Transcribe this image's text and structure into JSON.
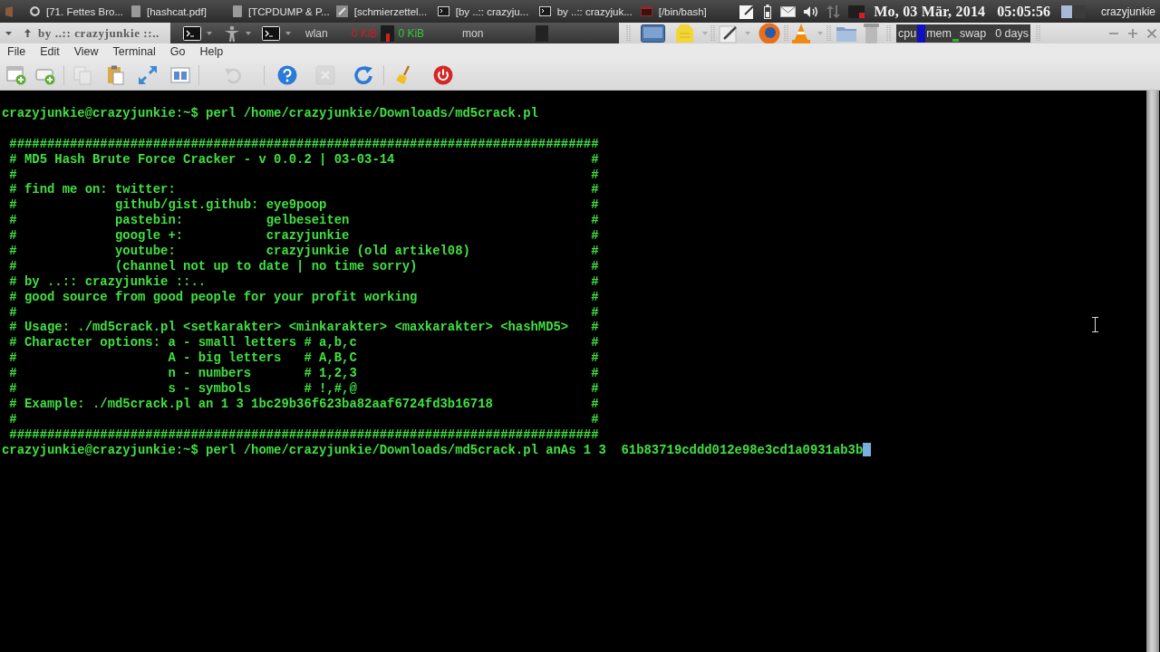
{
  "taskbar": {
    "tasks": [
      {
        "label": "[71. Fettes Bro..."
      },
      {
        "label": "[hashcat.pdf]"
      },
      {
        "label": "[TCPDUMP & P..."
      },
      {
        "label": "[schmierzettel..."
      },
      {
        "label": "[by ..:: crazyju..."
      },
      {
        "label": "by ..:: crazyjuk..."
      },
      {
        "label": "[/bin/bash]"
      }
    ],
    "date": "Mo, 03 Mär, 2014",
    "time": "05:05:56",
    "user": "crazyjunkie"
  },
  "window": {
    "title": "by ..:: crazyjunkie ::.."
  },
  "panel": {
    "network_label": "wlan",
    "upload": "0 KiB",
    "download": "0 KiB",
    "monitor_label": "mon",
    "system_monitor": {
      "cpu": "cpu",
      "mem": "mem",
      "swap": "swap",
      "uptime": "0 days"
    }
  },
  "menu": [
    "File",
    "Edit",
    "View",
    "Terminal",
    "Go",
    "Help"
  ],
  "toolbar": [
    {
      "disabled": false
    },
    {
      "disabled": false
    },
    {
      "disabled": true
    },
    {
      "disabled": false
    },
    {
      "disabled": false
    },
    {
      "disabled": false
    },
    {
      "disabled": true
    },
    {
      "disabled": false
    },
    {
      "disabled": true
    },
    {
      "disabled": false
    },
    {
      "disabled": false
    },
    {
      "disabled": false
    }
  ],
  "terminal": {
    "command": "crazyjunkie@crazyjunkie:~$ perl /home/crazyjunkie/Downloads/md5crack.pl",
    "banner": {
      "top": "##############################################################################",
      "rows": [
        {
          "text": "# MD5 Hash Brute Force Cracker - v 0.0.2 | 03-03-14",
          "edge": "#"
        },
        {
          "text": "#",
          "edge": "#"
        },
        {
          "text": "# find me on: twitter:",
          "edge": "#"
        },
        {
          "text": "#             github/gist.github: eye9poop",
          "edge": "#"
        },
        {
          "text": "#             pastebin:           gelbeseiten",
          "edge": "#"
        },
        {
          "text": "#             google +:           crazyjunkie",
          "edge": "#"
        },
        {
          "text": "#             youtube:            crazyjunkie (old artikel08)",
          "edge": "#"
        },
        {
          "text": "#             (channel not up to date | no time sorry)",
          "edge": "#"
        },
        {
          "text": "# by ..:: crazyjunkie ::..",
          "edge": "#"
        },
        {
          "text": "# good source from good people for your profit working",
          "edge": "#"
        },
        {
          "text": "#",
          "edge": "#"
        },
        {
          "text": "# Usage: ./md5crack.pl <setkarakter> <minkarakter> <maxkarakter> <hashMD5>",
          "edge": "#"
        },
        {
          "text": "# Character options: a - small letters # a,b,c",
          "edge": "#"
        },
        {
          "text": "#                    A - big letters   # A,B,C",
          "edge": "#"
        },
        {
          "text": "#                    n - numbers       # 1,2,3",
          "edge": "#"
        },
        {
          "text": "#                    s - symbols       # !,#,@",
          "edge": "#"
        },
        {
          "text": "# Example: ./md5crack.pl an 1 3 1bc29b36f623ba82aaf6724fd3b16718",
          "edge": "#"
        },
        {
          "text": "#",
          "edge": "#"
        }
      ],
      "bottom": "##############################################################################"
    },
    "prompt": "crazyjunkie@crazyjunkie:~$ perl /home/crazyjunkie/Downloads/md5crack.pl anAs 1 3  61b83719cddd012e98e3cd1a0931ab3b"
  }
}
